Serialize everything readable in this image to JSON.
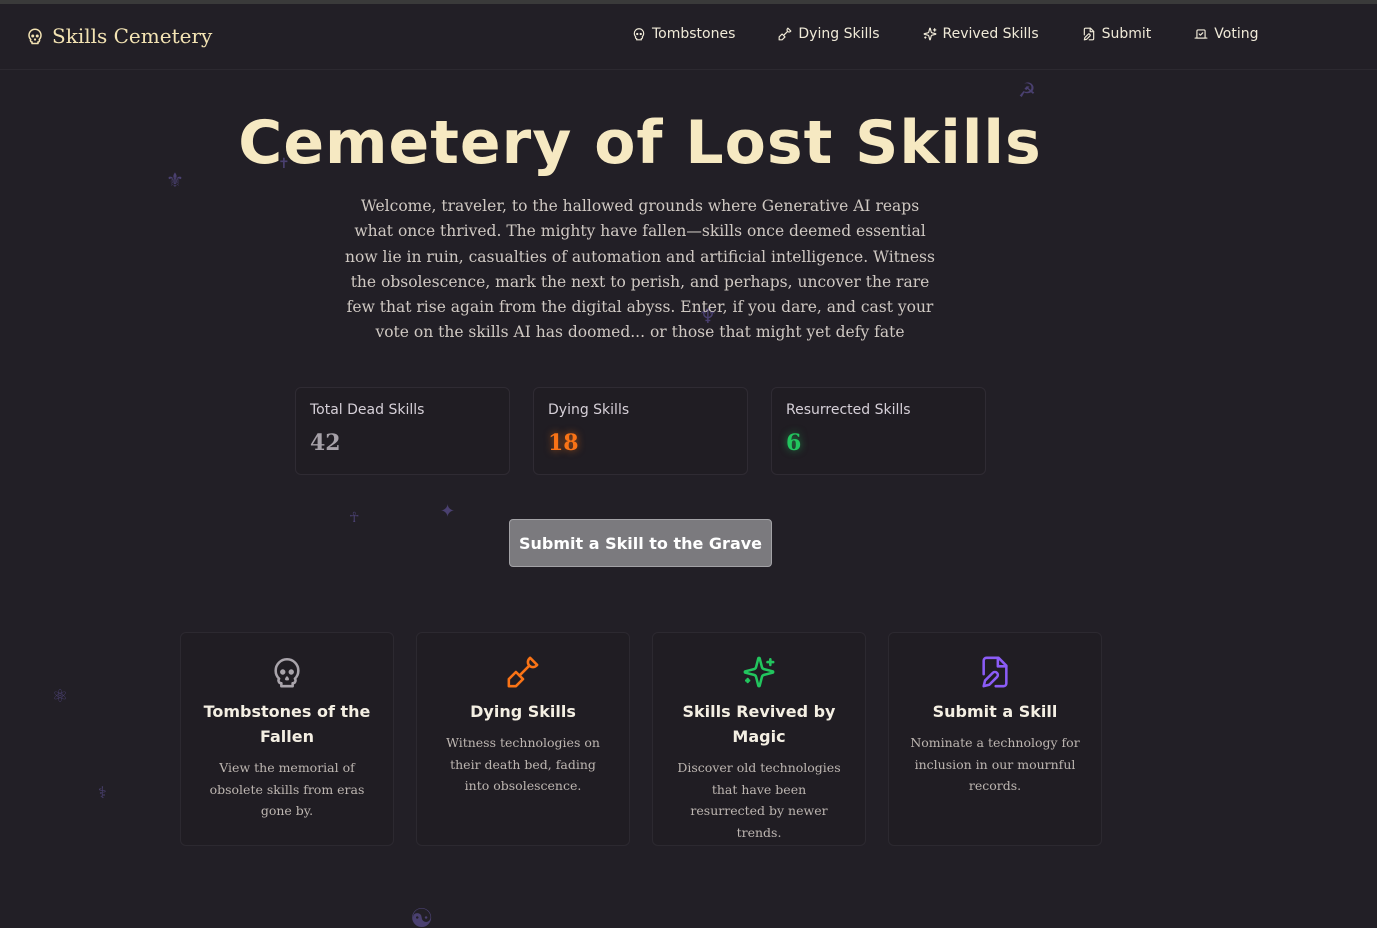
{
  "header": {
    "brand": "Skills Cemetery",
    "nav": [
      {
        "label": "Tombstones",
        "icon": "skull-icon"
      },
      {
        "label": "Dying Skills",
        "icon": "shovel-icon"
      },
      {
        "label": "Revived Skills",
        "icon": "sparkles-icon"
      },
      {
        "label": "Submit",
        "icon": "file-edit-icon"
      },
      {
        "label": "Voting",
        "icon": "ballot-icon"
      }
    ]
  },
  "hero": {
    "title": "Cemetery of Lost Skills",
    "intro": "Welcome, traveler, to the hallowed grounds where Generative AI reaps what once thrived. The mighty have fallen—skills once deemed essential now lie in ruin, casualties of automation and artificial intelligence. Witness the obsolescence, mark the next to perish, and perhaps, uncover the rare few that rise again from the digital abyss. Enter, if you dare, and cast your vote on the skills AI has doomed... or those that might yet defy fate"
  },
  "stats": [
    {
      "label": "Total Dead Skills",
      "value": "42",
      "color": "#a6a1a8"
    },
    {
      "label": "Dying Skills",
      "value": "18",
      "color": "#f97316"
    },
    {
      "label": "Resurrected Skills",
      "value": "6",
      "color": "#22c55e"
    }
  ],
  "cta": {
    "label": "Submit a Skill to the Grave"
  },
  "features": [
    {
      "title": "Tombstones of the Fallen",
      "desc": "View the memorial of obsolete skills from eras gone by.",
      "icon": "skull-icon",
      "color": "#a9a4ab"
    },
    {
      "title": "Dying Skills",
      "desc": "Witness technologies on their death bed, fading into obsolescence.",
      "icon": "shovel-icon",
      "color": "#f97316"
    },
    {
      "title": "Skills Revived by Magic",
      "desc": "Discover old technologies that have been resurrected by newer trends.",
      "icon": "sparkles-icon",
      "color": "#22c55e"
    },
    {
      "title": "Submit a Skill",
      "desc": "Nominate a technology for inclusion in our mournful records.",
      "icon": "file-edit-icon",
      "color": "#8b5cf6"
    }
  ]
}
